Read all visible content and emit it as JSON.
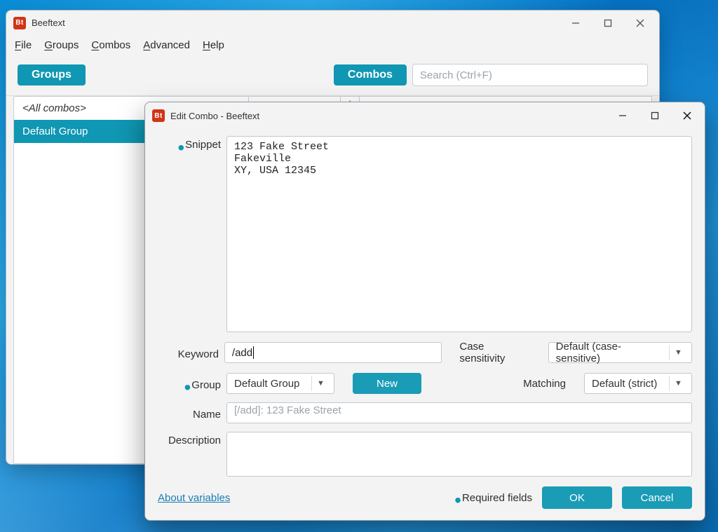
{
  "main": {
    "title": "Beeftext",
    "logo": "Bt",
    "menus": [
      "File",
      "Groups",
      "Combos",
      "Advanced",
      "Help"
    ],
    "buttons": {
      "groups": "Groups",
      "combos": "Combos"
    },
    "search_placeholder": "Search (Ctrl+F)",
    "sidebar": {
      "all_label": "<All combos>",
      "items": [
        "Default Group"
      ]
    }
  },
  "dialog": {
    "title": "Edit Combo - Beeftext",
    "logo": "Bt",
    "labels": {
      "snippet": "Snippet",
      "keyword": "Keyword",
      "group": "Group",
      "name": "Name",
      "description": "Description",
      "case_sensitivity": "Case sensitivity",
      "matching": "Matching"
    },
    "snippet_value": "123 Fake Street\nFakeville\nXY, USA 12345",
    "keyword_value": "/add",
    "group_value": "Default Group",
    "case_value": "Default (case-sensitive)",
    "matching_value": "Default (strict)",
    "name_placeholder": "[/add]: 123 Fake Street",
    "name_value": "",
    "description_value": "",
    "buttons": {
      "new": "New",
      "ok": "OK",
      "cancel": "Cancel"
    },
    "link": "About variables",
    "required_note": "Required fields"
  }
}
